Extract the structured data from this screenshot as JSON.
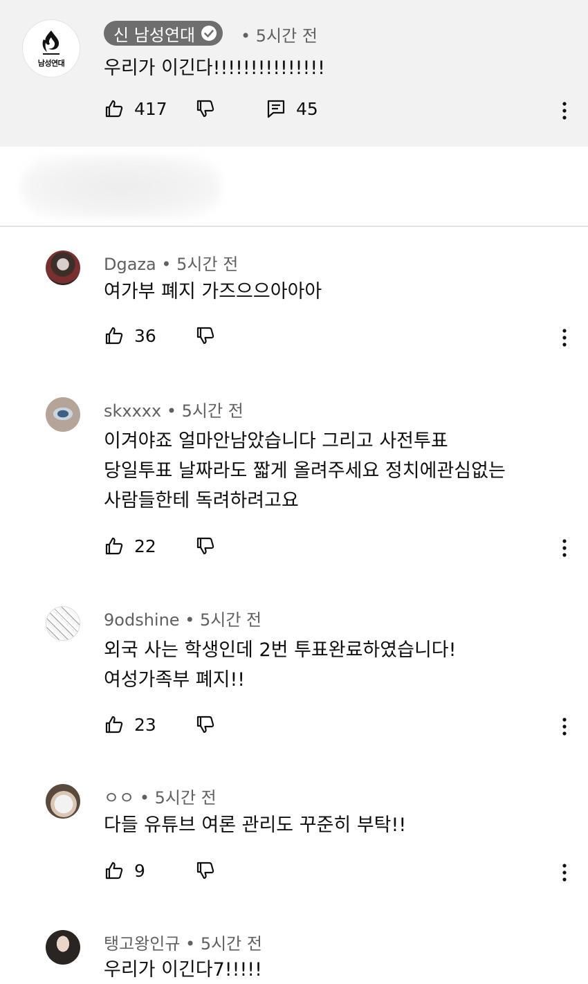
{
  "pinned": {
    "avatar_text": "남성연대",
    "author": "신 남성연대",
    "time": "• 5시간 전",
    "text": "우리가 이긴다!!!!!!!!!!!!!!!",
    "likes": "417",
    "replies": "45"
  },
  "comments": [
    {
      "author": "Dgaza",
      "time": "• 5시간 전",
      "lines": [
        "여가부 폐지 가즈으으아아아"
      ],
      "likes": "36"
    },
    {
      "author": "skxxxx",
      "time": "• 5시간 전",
      "lines": [
        "이겨야죠 얼마안남았습니다 그리고 사전투표",
        "당일투표 날짜라도 짧게 올려주세요 정치에관심없는",
        "사람들한테 독려하려고요"
      ],
      "likes": "22"
    },
    {
      "author": "9odshine",
      "time": "• 5시간 전",
      "lines": [
        "외국 사는 학생인데 2번 투표완료하였습니다!",
        "여성가족부 폐지!!"
      ],
      "likes": "23"
    },
    {
      "author": "ㅇㅇ",
      "time": "• 5시간 전",
      "lines": [
        "다들 유튜브 여론 관리도 꾸준히 부탁!!"
      ],
      "likes": "9"
    },
    {
      "author": "탱고왕인규",
      "time": "• 5시간 전",
      "lines": [
        "우리가 이긴다7!!!!!"
      ],
      "likes": ""
    }
  ]
}
